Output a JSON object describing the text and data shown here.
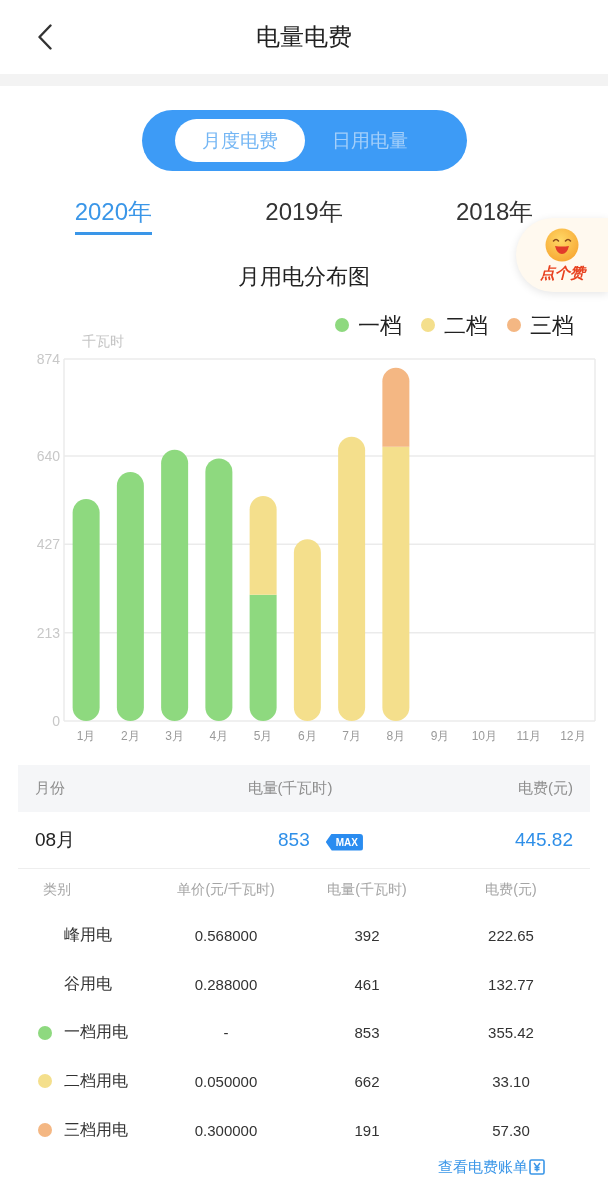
{
  "header": {
    "title": "电量电费"
  },
  "mode_toggle": [
    {
      "label": "月度电费",
      "selected": true
    },
    {
      "label": "日用电量",
      "selected": false
    }
  ],
  "year_tabs": [
    {
      "label": "2020年",
      "selected": true
    },
    {
      "label": "2019年",
      "selected": false
    },
    {
      "label": "2018年",
      "selected": false
    }
  ],
  "like_button": {
    "label": "点个赞"
  },
  "chart": {
    "title": "月用电分布图",
    "chart_data": {
      "type": "bar",
      "stacked": true,
      "grid": true,
      "legend": true,
      "ylabel": "千瓦时",
      "categories": [
        "1月",
        "2月",
        "3月",
        "4月",
        "5月",
        "6月",
        "7月",
        "8月",
        "9月",
        "10月",
        "11月",
        "12月"
      ],
      "series": [
        {
          "name": "一档",
          "color": "#8ed97f",
          "values": [
            536,
            601,
            655,
            634,
            305,
            null,
            null,
            null,
            null,
            null,
            null,
            null
          ]
        },
        {
          "name": "二档",
          "color": "#f4df8c",
          "values": [
            null,
            null,
            null,
            null,
            238,
            439,
            686,
            662,
            null,
            null,
            null,
            null
          ]
        },
        {
          "name": "三档",
          "color": "#f4b783",
          "values": [
            null,
            null,
            null,
            null,
            null,
            null,
            null,
            191,
            null,
            null,
            null,
            null
          ]
        }
      ],
      "ylim": [
        0,
        874
      ],
      "yticks": [
        0,
        213,
        427,
        640,
        874
      ]
    }
  },
  "summary": {
    "columns": [
      "月份",
      "电量(千瓦时)",
      "电费(元)"
    ],
    "row": {
      "month": "08月",
      "usage": "853",
      "badge": "MAX",
      "fee": "445.82"
    }
  },
  "details": {
    "columns": [
      "类别",
      "单价(元/千瓦时)",
      "电量(千瓦时)",
      "电费(元)"
    ],
    "rows": [
      {
        "category": "峰用电",
        "unit_price": "0.568000",
        "usage": "392",
        "fee": "222.65"
      },
      {
        "category": "谷用电",
        "unit_price": "0.288000",
        "usage": "461",
        "fee": "132.77"
      },
      {
        "category": "一档用电",
        "color": "#8ed97f",
        "unit_price": "-",
        "usage": "853",
        "fee": "355.42"
      },
      {
        "category": "二档用电",
        "color": "#f4df8c",
        "unit_price": "0.050000",
        "usage": "662",
        "fee": "33.10"
      },
      {
        "category": "三档用电",
        "color": "#f4b783",
        "unit_price": "0.300000",
        "usage": "191",
        "fee": "57.30"
      }
    ]
  },
  "bill_link": {
    "label": "查看电费账单"
  }
}
